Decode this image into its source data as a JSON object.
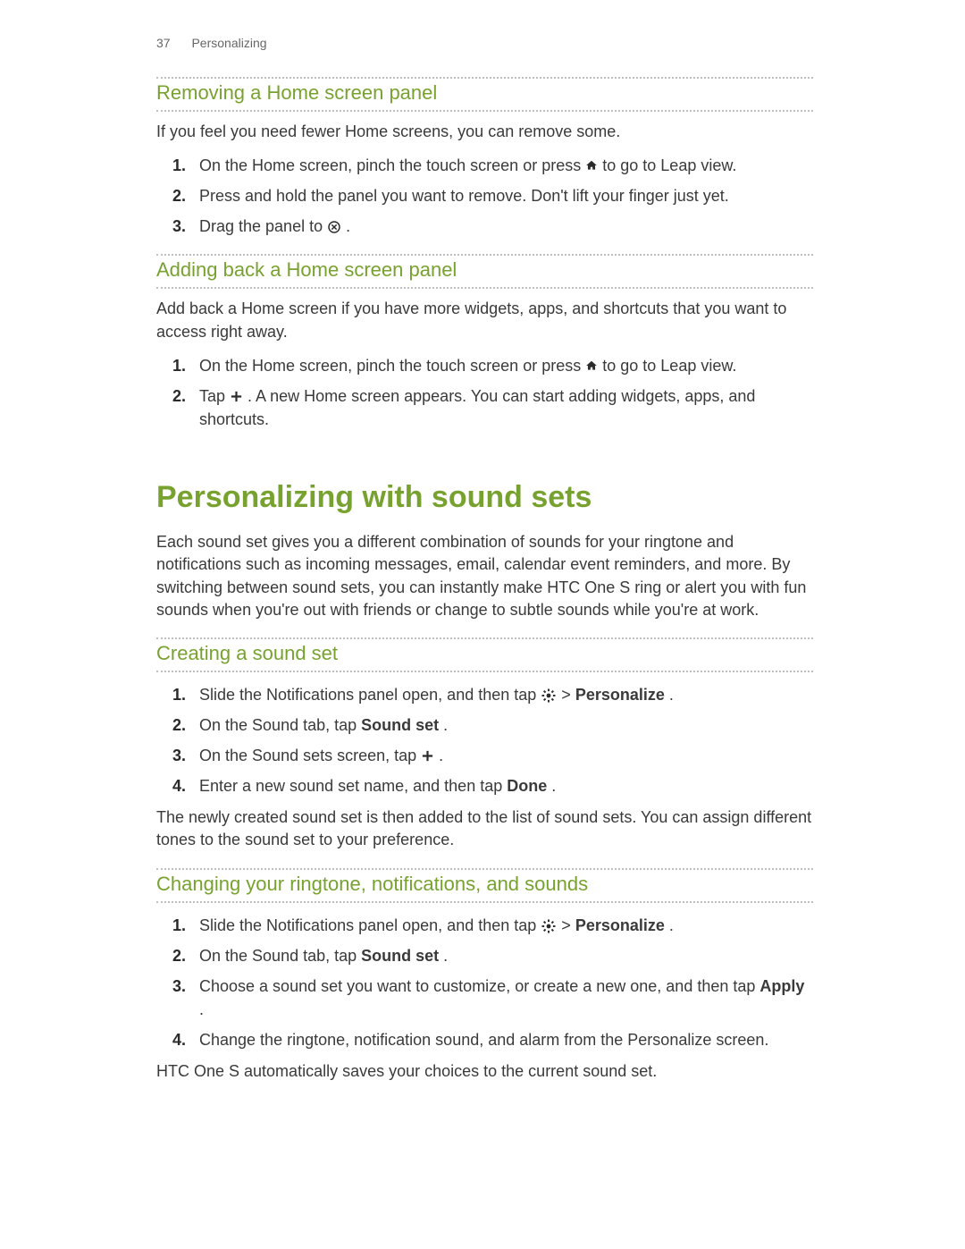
{
  "header": {
    "page_number": "37",
    "section": "Personalizing"
  },
  "sec1": {
    "title": "Removing a Home screen panel",
    "intro": "If you feel you need fewer Home screens, you can remove some.",
    "steps": {
      "s1a": "On the Home screen, pinch the touch screen or press ",
      "s1b": " to go to Leap view.",
      "s2": "Press and hold the panel you want to remove. Don't lift your finger just yet.",
      "s3a": "Drag the panel to ",
      "s3b": "."
    }
  },
  "sec2": {
    "title": "Adding back a Home screen panel",
    "intro": "Add back a Home screen if you have more widgets, apps, and shortcuts that you want to access right away.",
    "steps": {
      "s1a": "On the Home screen, pinch the touch screen or press ",
      "s1b": " to go to Leap view.",
      "s2a": "Tap ",
      "s2b": ". A new Home screen appears. You can start adding widgets, apps, and shortcuts."
    }
  },
  "bighead": "Personalizing with sound sets",
  "bigpara": "Each sound set gives you a different combination of sounds for your ringtone and notifications such as incoming messages, email, calendar event reminders, and more. By switching between sound sets, you can instantly make HTC One S ring or alert you with fun sounds when you're out with friends or change to subtle sounds while you're at work.",
  "sec3": {
    "title": "Creating a sound set",
    "steps": {
      "s1a": "Slide the Notifications panel open, and then tap ",
      "s1b": " > ",
      "s1c": "Personalize",
      "s1d": ".",
      "s2a": "On the Sound tab, tap ",
      "s2b": "Sound set",
      "s2c": ".",
      "s3a": "On the Sound sets screen, tap ",
      "s3b": ".",
      "s4a": "Enter a new sound set name, and then tap ",
      "s4b": "Done",
      "s4c": "."
    },
    "outro": "The newly created sound set is then added to the list of sound sets. You can assign different tones to the sound set to your preference."
  },
  "sec4": {
    "title": "Changing your ringtone, notifications, and sounds",
    "steps": {
      "s1a": "Slide the Notifications panel open, and then tap ",
      "s1b": " > ",
      "s1c": "Personalize",
      "s1d": ".",
      "s2a": "On the Sound tab, tap ",
      "s2b": "Sound set",
      "s2c": ".",
      "s3a": "Choose a sound set you want to customize, or create a new one, and then tap ",
      "s3b": "Apply",
      "s3c": ".",
      "s4": "Change the ringtone, notification sound, and alarm from the Personalize screen."
    },
    "outro": "HTC One S automatically saves your choices to the current sound set."
  }
}
